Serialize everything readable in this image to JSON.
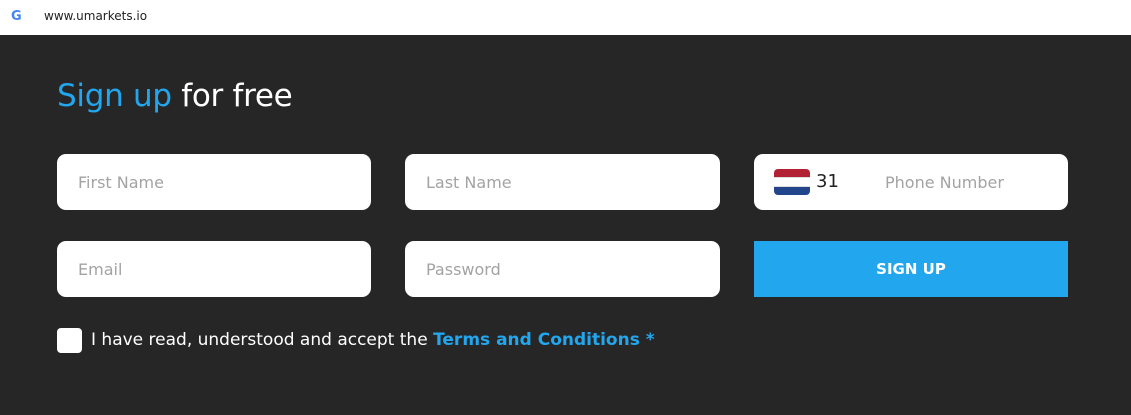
{
  "browser": {
    "url": "www.umarkets.io",
    "favicon_icon": "google-g-icon",
    "favicon_letter": "G"
  },
  "form": {
    "heading_accent": "Sign up",
    "heading_rest": " for free",
    "first_name_placeholder": "First Name",
    "last_name_placeholder": "Last Name",
    "phone": {
      "flag_icon": "netherlands-flag-icon",
      "dial_code": "31",
      "placeholder": "Phone Number"
    },
    "email_placeholder": "Email",
    "password_placeholder": "Password",
    "submit_label": "SIGN UP",
    "terms_text": "I have read, understood and accept the ",
    "terms_link": "Terms and Conditions *"
  },
  "colors": {
    "background": "#262626",
    "accent": "#22a6ee",
    "field": "#ffffff",
    "placeholder": "#a3a3a3"
  }
}
